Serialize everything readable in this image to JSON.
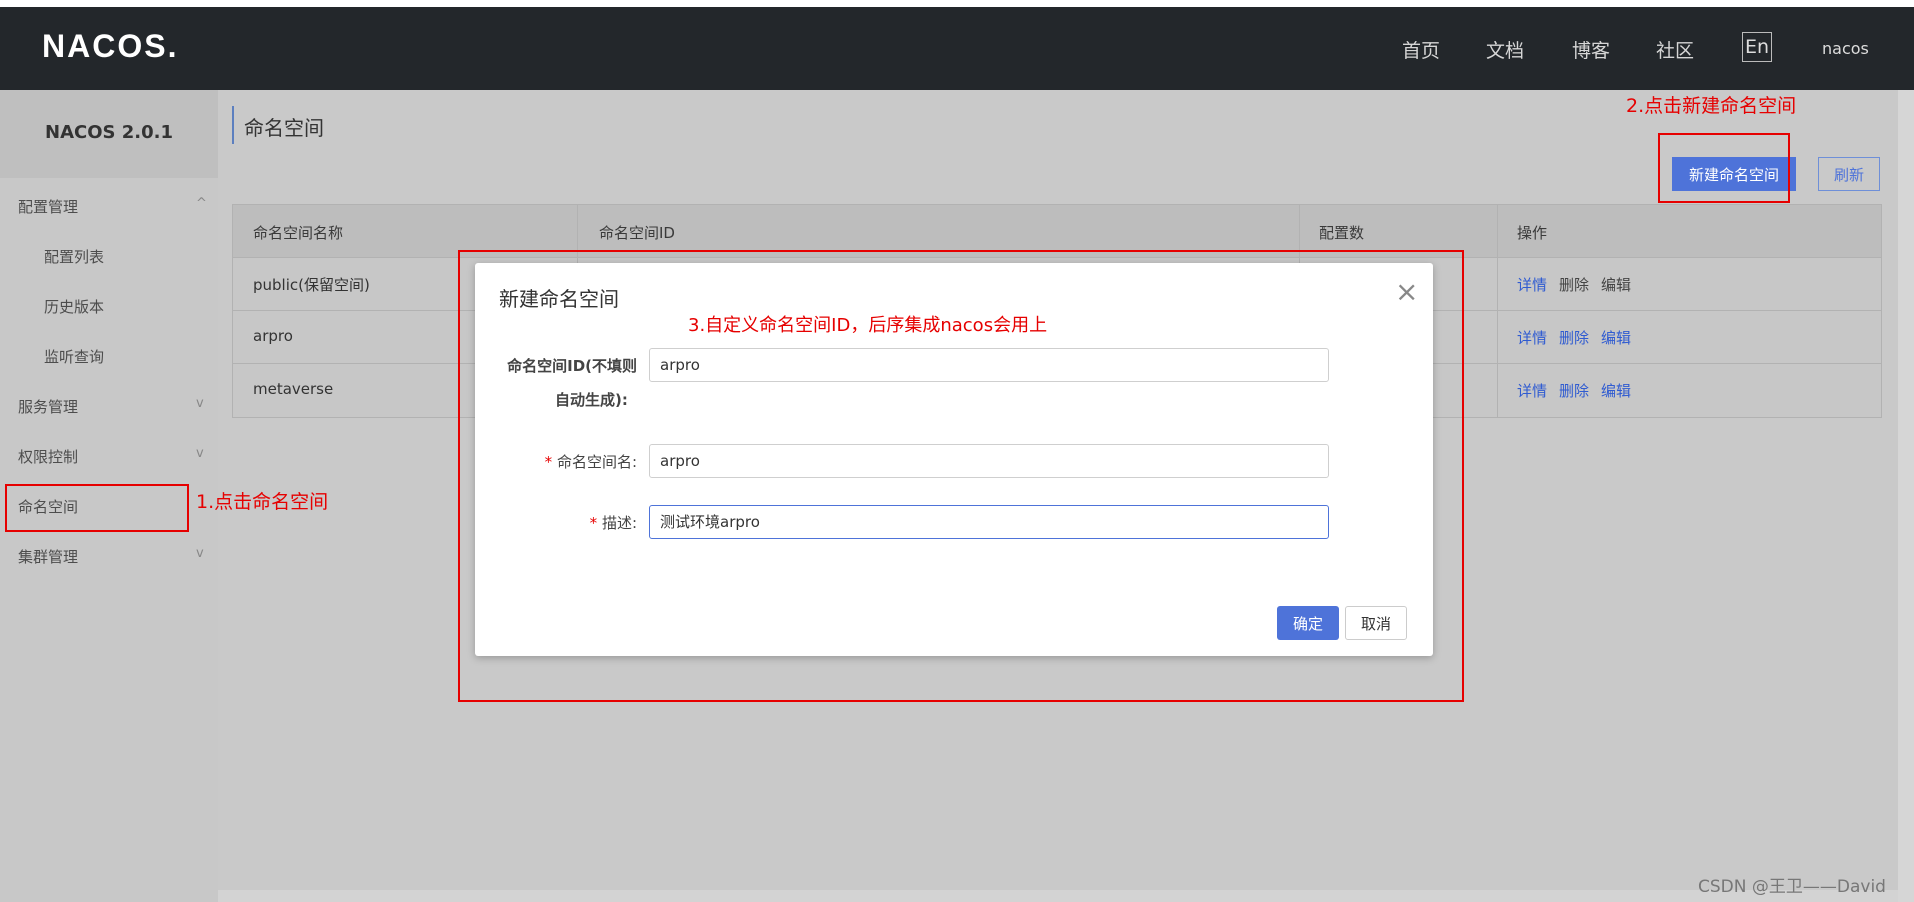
{
  "header": {
    "logo": "NACOS.",
    "nav": [
      "首页",
      "文档",
      "博客",
      "社区"
    ],
    "lang": "En",
    "user": "nacos"
  },
  "sidebar": {
    "version": "NACOS 2.0.1",
    "items": [
      {
        "label": "配置管理",
        "chevron": "^"
      },
      {
        "label": "配置列表"
      },
      {
        "label": "历史版本"
      },
      {
        "label": "监听查询"
      },
      {
        "label": "服务管理",
        "chevron": "v"
      },
      {
        "label": "权限控制",
        "chevron": "v"
      },
      {
        "label": "命名空间"
      },
      {
        "label": "集群管理",
        "chevron": "v"
      }
    ]
  },
  "page": {
    "title": "命名空间",
    "create_button": "新建命名空间",
    "refresh_button": "刷新"
  },
  "table": {
    "columns": [
      "命名空间名称",
      "命名空间ID",
      "配置数",
      "操作"
    ],
    "rows": [
      {
        "name": "public(保留空间)"
      },
      {
        "name": "arpro"
      },
      {
        "name": "metaverse"
      }
    ],
    "actions": [
      "详情",
      "删除",
      "编辑"
    ]
  },
  "modal": {
    "title": "新建命名空间",
    "close": "×",
    "fields": {
      "id_label_line1": "命名空间ID(不填则",
      "id_label_line2": "自动生成):",
      "id_value": "arpro",
      "name_label": "命名空间名:",
      "name_value": "arpro",
      "desc_label": "描述:",
      "desc_value": "测试环境arpro"
    },
    "ok_button": "确定",
    "cancel_button": "取消"
  },
  "annotations": {
    "step1": "1.点击命名空间",
    "step2": "2.点击新建命名空间",
    "step3": "3.自定义命名空间ID，后序集成nacos会用上"
  },
  "watermark": "CSDN @王卫——David"
}
